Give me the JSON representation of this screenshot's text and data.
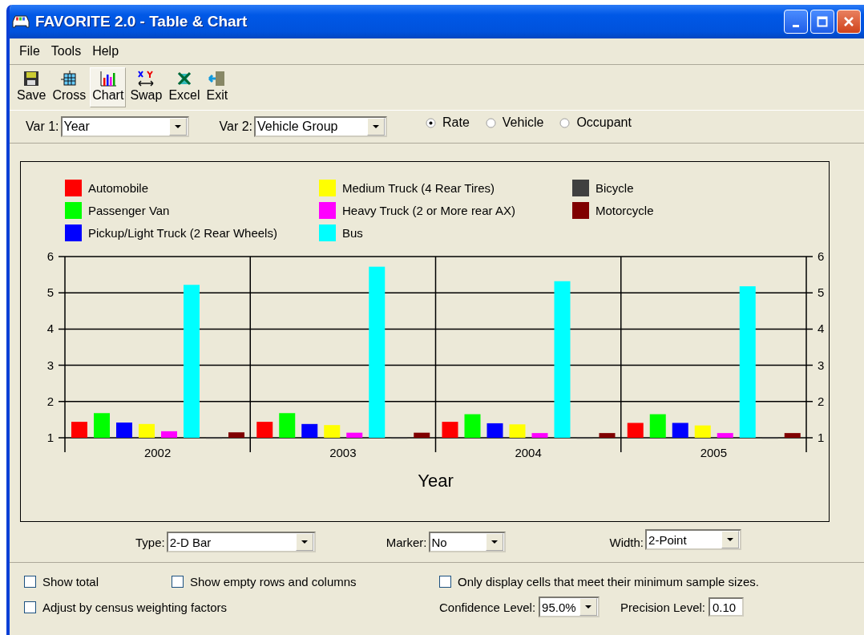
{
  "window": {
    "title": "FAVORITE 2.0 - Table & Chart"
  },
  "menu": [
    {
      "label": "File"
    },
    {
      "label": "Tools"
    },
    {
      "label": "Help"
    }
  ],
  "toolbar": [
    {
      "label": "Save",
      "kind": "save",
      "selected": false
    },
    {
      "label": "Cross",
      "kind": "cross",
      "selected": false
    },
    {
      "label": "Chart",
      "kind": "chart",
      "selected": true
    },
    {
      "label": "Swap",
      "kind": "swap",
      "selected": false
    },
    {
      "label": "Excel",
      "kind": "excel",
      "selected": false
    },
    {
      "label": "Exit",
      "kind": "exit",
      "selected": false
    }
  ],
  "var1": {
    "label": "Var 1:",
    "value": "Year"
  },
  "var2": {
    "label": "Var 2:",
    "value": "Vehicle Group"
  },
  "measure": [
    {
      "label": "Rate",
      "selected": true
    },
    {
      "label": "Vehicle",
      "selected": false
    },
    {
      "label": "Occupant",
      "selected": false
    }
  ],
  "right_axis_labels": [
    "6",
    "5",
    "4",
    "3",
    "2",
    "1"
  ],
  "chart_data": {
    "type": "bar",
    "grid": true,
    "legend": true,
    "xlabel": "Year",
    "categories": [
      "2002",
      "2003",
      "2004",
      "2005"
    ],
    "ylim": [
      1,
      6
    ],
    "yticks": [
      1,
      2,
      3,
      4,
      5,
      6
    ],
    "series": [
      {
        "name": "Automobile",
        "color": "#ff0000",
        "values": [
          1.44,
          1.44,
          1.44,
          1.41
        ]
      },
      {
        "name": "Passenger Van",
        "color": "#00ff00",
        "values": [
          1.68,
          1.68,
          1.65,
          1.65
        ]
      },
      {
        "name": "Pickup/Light Truck (2 Rear Wheels)",
        "color": "#0000ff",
        "values": [
          1.42,
          1.38,
          1.4,
          1.41
        ]
      },
      {
        "name": "Medium Truck (4 Rear Tires)",
        "color": "#ffff00",
        "values": [
          1.38,
          1.35,
          1.37,
          1.34
        ]
      },
      {
        "name": "Heavy Truck (2 or More rear AX)",
        "color": "#ff00ff",
        "values": [
          1.18,
          1.14,
          1.13,
          1.13
        ]
      },
      {
        "name": "Bus",
        "color": "#00ffff",
        "values": [
          5.22,
          5.72,
          5.32,
          5.18
        ]
      },
      {
        "name": "Bicycle",
        "color": "#404040",
        "values": [
          1.02,
          1.02,
          1.02,
          1.02
        ]
      },
      {
        "name": "Motorcycle",
        "color": "#800000",
        "values": [
          1.15,
          1.14,
          1.13,
          1.13
        ]
      }
    ]
  },
  "chart_options": [
    {
      "label": "Type:",
      "value": "2-D Bar"
    },
    {
      "label": "Marker:",
      "value": "No"
    },
    {
      "label": "Width:",
      "value": "2-Point"
    }
  ],
  "options": [
    {
      "label": "Show total",
      "checked": false
    },
    {
      "label": "Show empty rows and columns",
      "checked": false
    },
    {
      "label": "Only display cells that meet their minimum sample sizes.",
      "checked": false
    },
    {
      "label": "Adjust by census weighting factors",
      "checked": false
    }
  ],
  "confidence": {
    "label": "Confidence Level:",
    "value": "95.0%"
  },
  "precision": {
    "label": "Precision Level:",
    "value": "0.10"
  }
}
